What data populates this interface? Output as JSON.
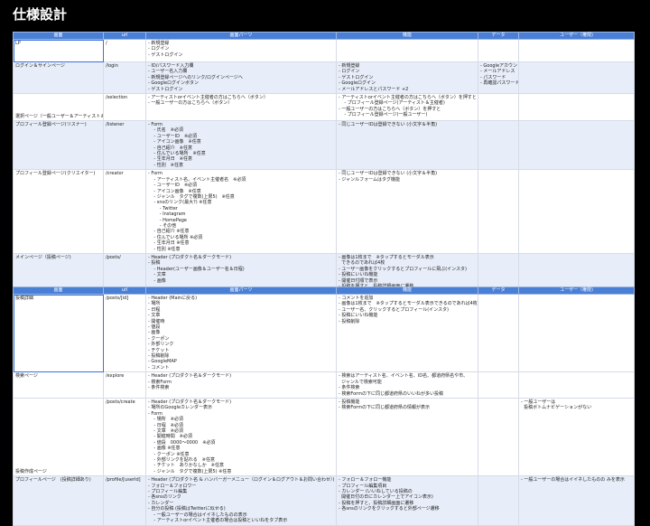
{
  "title": "仕様設計",
  "headers": [
    "画面",
    "url",
    "画面パーツ",
    "機能",
    "データ",
    "ユーザー（権限)"
  ],
  "table1": [
    {
      "name": "LP",
      "url": "/",
      "parts": "- 新規登録\n- ログイン\n- ゲストログイン",
      "func": "",
      "data": "",
      "user": ""
    },
    {
      "name": "ログイン＆サインページ",
      "url": "/login",
      "parts": "- ID/パスワード入力欄\n- ユーザー名入力欄\n- 新規登録ページへのリンク/ログインページへ\n- Googleログインボタン\n- ゲストログイン",
      "func": "- 新規登録\n- ログイン\n- ゲストログイン\n- Googleログイン\n- メールアドレスとパスワード +2",
      "data": "- Googleアカウント\n- メールアドレス\n- パスワード\n- 再確認パスワード",
      "user": ""
    },
    {
      "name": "選択ページ（一般ユーザー＆アーティスト＆",
      "url": "/selection",
      "parts": "- アーティストorイベント主催者の方はこちらへ（ボタン）\n- 一般ユーザーの方はこちらへ（ボタン）",
      "func": "- アーティストorイベント主催者の方はこちらへ（ボタン）を押すと\n    - プロフィール登録ページ(アーティスト＆主催者)\n- 一般ユーザーの方はこちらへ（ボタン）を押すと\n    - プロフィール登録ページ(一般ユーザー)",
      "data": "",
      "user": ""
    },
    {
      "name": "プロフィール登録ページ(リスナー)",
      "url": "/listener",
      "parts": "- Form\n    - 氏名　※必須\n    - ユーザーID　※必須\n    - アイコン画像　※任意\n    - 自己紹介　※任意\n    - 住んでいる場所　※任意\n    - 生年月日　※任意\n    - 性別　※任意",
      "func": "- 同じユーザーIDは登録できない (小文字＆半角)",
      "data": "",
      "user": ""
    },
    {
      "name": "プロフィール登録ページ(クリエイター)",
      "url": "/creator",
      "parts": "- Form\n    - アーティスト名、イベント主催者名　※必須\n    - ユーザーID　※必須\n    - アイコン画像　※任意\n    - ジャンル　タグで複数(上限5)　※任意\n    - snsのリンク(最大?) ※任意\n        - Twitter\n        - Instagram\n        - HomePage\n        - その他\n    - 自己紹介 ※任意\n    - 住んでいる場所 ※必須\n    - 生年月日 ※任意\n    - 性別 ※任意",
      "func": "- 同じユーザーIDは登録できない (小文字＆半角)\n- ジャンルフォームはタグ機能",
      "data": "",
      "user": ""
    },
    {
      "name": "メインページ（投稿ページ)",
      "url": "/posts/",
      "parts": "- Header (プロダクト名＆ダークモード)\n- 投稿\n    - Header(ユーザー画像＆ユーザー名＆日程)\n    - 文章\n    - 画像",
      "func": "- 画像は1枚まで　※タップするとモーダル表示\n  できるのであれば4枚\n- ユーザー画像をクリックするとプロフィールに飛ぶ(インスタ)\n- 投稿にいいね機能\n- 開催日付順で表示\n- 投稿を押すと、投稿詳細画面に遷移",
      "data": "",
      "user": ""
    }
  ],
  "table2": [
    {
      "name": "投稿詳細",
      "url": "/posts/[id]",
      "parts": "- Header (Mainに戻る)\n- 場所\n- 日程\n- 文章\n- 開催時\n- 値段\n- 画像\n- クーポン\n- 外部リンク\n- チケット\n- 投稿削除\n- GoogleMAP\n- コメント",
      "func": "- コメントを追加\n- 画像は1枚まで　※タップするとモーダル表示できるのであれば4枚\n- ユーザー名、クリックするとプロフィール(インスタ)\n- 投稿にいいね機能\n- 投稿削除",
      "data": "",
      "user": ""
    },
    {
      "name": "検索ページ",
      "url": "/explore",
      "parts": "- Header (プロダクト名＆ダークモード)\n- 検索Form\n- 条件検索",
      "func": "- 検索はアーティスト名、イベント名、ID名、都道府県名や市、\n  ジャンルで検索可能\n- 条件検索\n- 検索Formの下に同じ都道府県のいいねが多い投稿",
      "data": "",
      "user": ""
    },
    {
      "name": "投稿作成ページ",
      "url": "/posts/create",
      "parts": "- Header (プロダクト名＆ダークモード)\n- 場所のGoogleカレンダー表示\n- Form\n    - 場所　※必須\n    - 日程　※必須\n    - 文章　※必須\n    - 開催時間　※必須\n    - 値段　0000〜0000　※必須\n    - 画像 ※任意\n    - クーポン ※任意\n    - 外部リンクを貼れる　※任意\n    - チケット　ありかなしか　※任意\n    - ジャンル　タグで複数(上限5) ※任意",
      "func": "- 投稿機能\n- 検索Formの下に同じ都道府県の情報が表示",
      "data": "",
      "user": "- 一般ユーザーは\n  投稿ボトムナビゲーションがない"
    },
    {
      "name": "プロフィールページ　(投稿詳細あり)",
      "url": "/profile/[userId]",
      "parts": "- Header (プロダクト名 & ハンバーガーメニュー（ログイン＆ログアウト＆お問い合わせ）)\n- フォロー＆フォロワー\n- プロフィール編集\n- 各snsのリンク\n- カレンダー\n- 自分の投稿 (投稿はTwitterに似せる)\n    - 一般ユーザーの場合はイイネしたものの表示\n    - アーティストorイベント主催者の場合は投稿といいねをタブ表示",
      "func": "- フォロー＆フォロー機能\n- プロフィール編集項目\n- カレンダー (いいねしている投稿の\n  開催日付の日にカレンダー上でアイコン表示)\n- 投稿を押すと、投稿詳細画面に遷移\n- 各snsのリンクをクリックすると外部ページ遷移",
      "data": "",
      "user": "- 一般ユーザーの場合はイイネしたものの みを表示"
    }
  ]
}
